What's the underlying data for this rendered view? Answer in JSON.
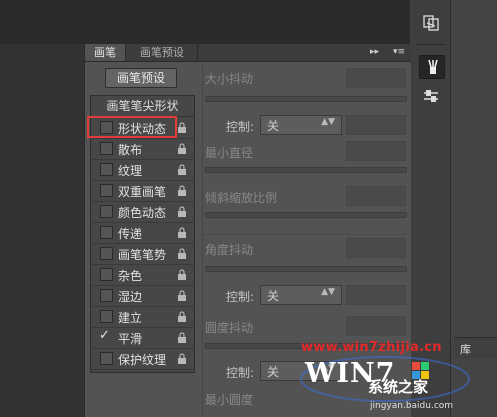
{
  "panel": {
    "tabs": [
      {
        "label": "画笔"
      },
      {
        "label": "画笔预设"
      }
    ],
    "preset_button": "画笔预设",
    "list_header": "画笔笔尖形状",
    "items": [
      {
        "label": "形状动态",
        "checked": false
      },
      {
        "label": "散布",
        "checked": false
      },
      {
        "label": "纹理",
        "checked": false
      },
      {
        "label": "双重画笔",
        "checked": false
      },
      {
        "label": "颜色动态",
        "checked": false
      },
      {
        "label": "传递",
        "checked": false
      },
      {
        "label": "画笔笔势",
        "checked": false
      },
      {
        "label": "杂色",
        "checked": false
      },
      {
        "label": "湿边",
        "checked": false
      },
      {
        "label": "建立",
        "checked": false
      },
      {
        "label": "平滑",
        "checked": true
      },
      {
        "label": "保护纹理",
        "checked": false
      }
    ],
    "check_mark": "✓",
    "options": {
      "size_jitter": "大小抖动",
      "control_label": "控制:",
      "control_value": "关",
      "min_diameter": "最小直径",
      "tilt_scale": "倾斜缩放比例",
      "angle_jitter": "角度抖动",
      "roundness_jitter": "圆度抖动",
      "min_roundness": "最小圆度"
    },
    "tab_controls": {
      "collapse": "▸▸",
      "menu": "▾≡"
    }
  },
  "right_panel": {
    "library_tab": "库"
  },
  "watermark": {
    "site": "www.win7zhijia.cn",
    "logo_text": "WIN7",
    "logo_sub": "系统之家",
    "url": "jingyan.baidu.com"
  },
  "colors": {
    "highlight": "#e33b3b",
    "panel_bg": "#535353",
    "watermark_red": "#e22a2a"
  }
}
